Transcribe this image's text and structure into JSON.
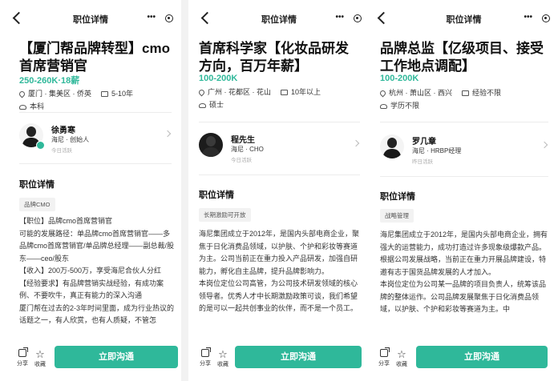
{
  "nav_title": "职位详情",
  "bottom": {
    "share": "分享",
    "favorite": "收藏",
    "cta": "立即沟通"
  },
  "section_title": "职位详情",
  "panels": [
    {
      "title": "【厦门帮品牌转型】cmo首席营销官",
      "salary": "250-260K·18薪",
      "location": "厦门 · 集美区 · 侨英",
      "experience": "5-10年",
      "education": "本科",
      "recruiter": {
        "name": "徐勇寒",
        "role": "海尼 · 创始人",
        "active": "今日活跃"
      },
      "tag": "品牌CMO",
      "paragraphs": [
        "【职位】品牌cmo首席营销官",
        "可能的发展路径：单品牌cmo首席营销官——多品牌cmo首席营销官/单品牌总经理——副总裁/股东——ceo/股东",
        "【收入】200万-500万，享受海尼合伙人分红",
        "【经验要求】有品牌营销实战经验，有成功案例、不要吹牛，真正有能力的深入沟通",
        "厦门帮在过去的2-3年时间里面，成为行业热议的话题之一，有人欣赏，也有人质疑，不管怎"
      ]
    },
    {
      "title": "首席科学家【化妆品研发方向，百万年薪】",
      "salary": "100-200K",
      "location": "广州 · 花都区 · 花山",
      "experience": "10年以上",
      "education": "硕士",
      "recruiter": {
        "name": "程先生",
        "role": "海尼 · CHO",
        "active": "今日活跃"
      },
      "tag": "长期激励可开放",
      "paragraphs": [
        "海尼集团成立于2012年，是国内头部电商企业，聚焦于日化消费品领域，以护肤、个护和彩妆等赛道为主。公司当前正在重力投入产品研发，加强自研能力，孵化自主品牌，提升品牌影响力。",
        "本岗位定位公司高管，为公司技术研发领域的核心领导者。优秀人才中长期激励政策可谈，我们希望的是可以一起共创事业的伙伴，而不是一个员工。"
      ]
    },
    {
      "title": "品牌总监【亿级项目、接受工作地点调配】",
      "salary": "100-200K",
      "location": "杭州 · 萧山区 · 西兴",
      "experience": "经验不限",
      "education": "学历不限",
      "recruiter": {
        "name": "罗几章",
        "role": "海尼 · HRBP经理",
        "active": "昨日活跃"
      },
      "tag": "战略管理",
      "paragraphs": [
        "海尼集团成立于2012年，是国内头部电商企业，拥有强大的运营能力，成功打造过许多现象级爆款产品。根据公司发展战略，当前正在重力开展品牌建设，特邀有志于国货品牌发展的人才加入。",
        "本岗位定位为公司某一品牌的项目负责人，统筹该品牌的整体运作。公司品牌发展聚焦于日化消费品领域，以护肤、个护和彩妆等赛道为主。中"
      ]
    }
  ]
}
